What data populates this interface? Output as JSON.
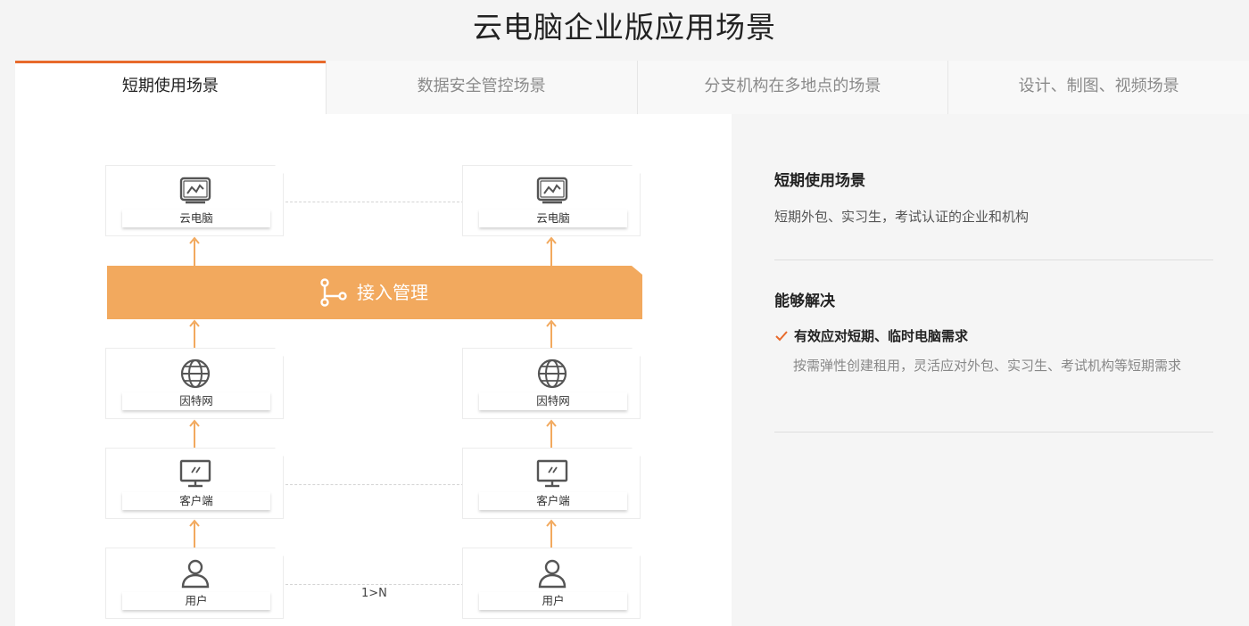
{
  "page": {
    "title": "云电脑企业版应用场景"
  },
  "tabs": [
    {
      "label": "短期使用场景",
      "active": true
    },
    {
      "label": "数据安全管控场景",
      "active": false
    },
    {
      "label": "分支机构在多地点的场景",
      "active": false
    },
    {
      "label": "设计、制图、视频场景",
      "active": false
    }
  ],
  "diagram": {
    "accent_color": "#f2a95e",
    "cloud_pc_label": "云电脑",
    "access_label": "接入管理",
    "internet_label": "因特网",
    "client_label": "客户端",
    "user_label": "用户",
    "ratio_label": "1>N"
  },
  "info": {
    "title": "短期使用场景",
    "description": "短期外包、实习生，考试认证的企业和机构",
    "solve_title": "能够解决",
    "benefit_title": "有效应对短期、临时电脑需求",
    "benefit_desc": "按需弹性创建租用，灵活应对外包、实习生、考试机构等短期需求"
  }
}
